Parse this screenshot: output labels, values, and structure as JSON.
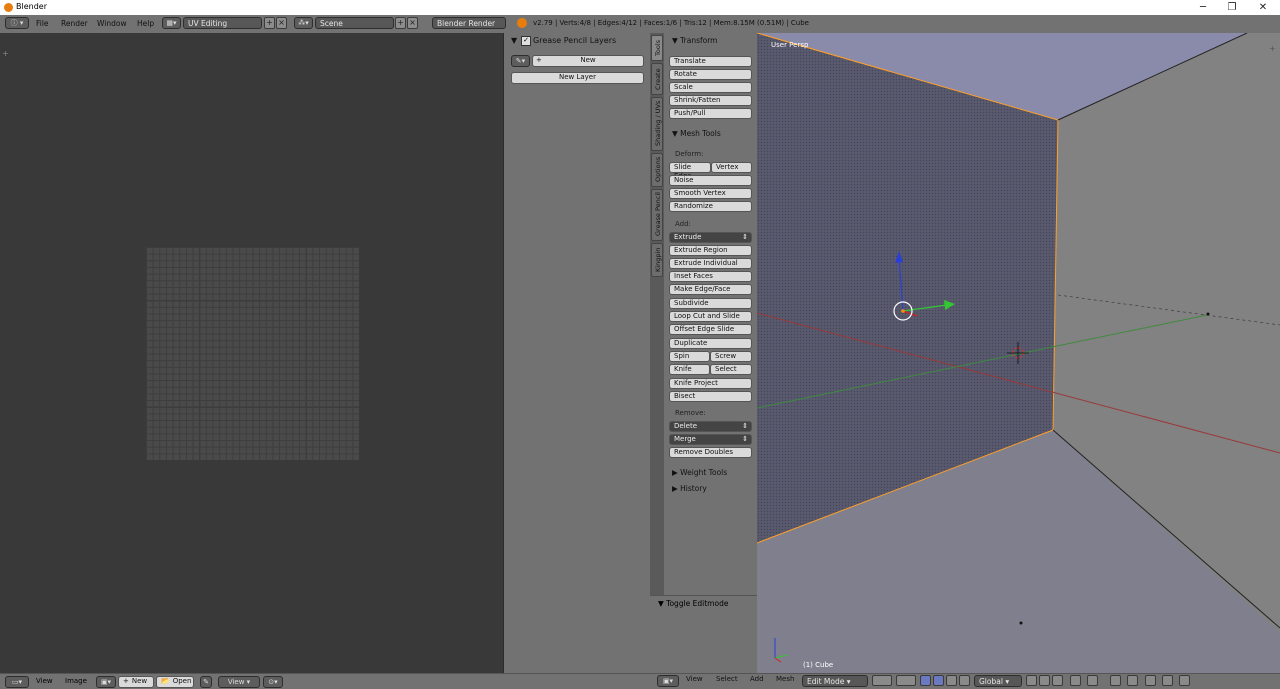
{
  "window": {
    "title": "Blender",
    "minimize": "─",
    "maximize": "❐",
    "close": "✕"
  },
  "infobar": {
    "menus": [
      "File",
      "Render",
      "Window",
      "Help"
    ],
    "screen_layout": "UV Editing",
    "scene": "Scene",
    "render_engine": "Blender Render",
    "stats": "v2.79 | Verts:4/8 | Edges:4/12 | Faces:1/6 | Tris:12 | Mem:8.15M (0.51M) | Cube"
  },
  "grease_pencil": {
    "title": "Grease Pencil Layers",
    "new_label": "New",
    "new_layer_label": "New Layer"
  },
  "tool_tabs": [
    "Tools",
    "Create",
    "Shading / UVs",
    "Options",
    "Grease Pencil",
    "Kingpin"
  ],
  "tools": {
    "transform": {
      "title": "Transform",
      "buttons": [
        "Translate",
        "Rotate",
        "Scale",
        "Shrink/Fatten",
        "Push/Pull"
      ]
    },
    "mesh_tools": {
      "title": "Mesh Tools",
      "deform_label": "Deform:",
      "slide_edge": "Slide Edge",
      "vertex": "Vertex",
      "noise": "Noise",
      "smooth_vertex": "Smooth Vertex",
      "randomize": "Randomize",
      "add_label": "Add:",
      "extrude": "Extrude",
      "add_buttons": [
        "Extrude Region",
        "Extrude Individual",
        "Inset Faces",
        "Make Edge/Face",
        "Subdivide",
        "Loop Cut and Slide",
        "Offset Edge Slide",
        "Duplicate"
      ],
      "spin": "Spin",
      "screw": "Screw",
      "knife": "Knife",
      "select": "Select",
      "knife_project": "Knife Project",
      "bisect": "Bisect",
      "remove_label": "Remove:",
      "delete": "Delete",
      "merge": "Merge",
      "remove_doubles": "Remove Doubles"
    },
    "weight_tools": "Weight Tools",
    "history": "History",
    "toggle_editmode": "Toggle Editmode"
  },
  "viewport": {
    "view_name": "User Persp",
    "object_info": "(1) Cube"
  },
  "uv_header": {
    "view": "View",
    "image": "Image",
    "new": "New",
    "open": "Open",
    "view2": "View"
  },
  "vp_header": {
    "view": "View",
    "select": "Select",
    "add": "Add",
    "mesh": "Mesh",
    "mode": "Edit Mode",
    "orientation": "Global"
  }
}
